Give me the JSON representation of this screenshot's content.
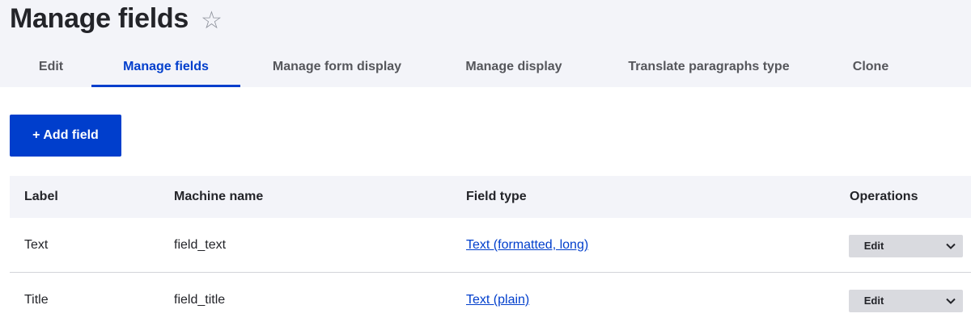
{
  "page": {
    "title": "Manage fields"
  },
  "tabs": [
    {
      "label": "Edit"
    },
    {
      "label": "Manage fields",
      "active": true
    },
    {
      "label": "Manage form display"
    },
    {
      "label": "Manage display"
    },
    {
      "label": "Translate paragraphs type"
    },
    {
      "label": "Clone"
    }
  ],
  "toolbar": {
    "add_field_label": "+ Add field"
  },
  "table": {
    "headers": [
      "Label",
      "Machine name",
      "Field type",
      "Operations"
    ],
    "rows": [
      {
        "label": "Text",
        "machine_name": "field_text",
        "field_type": "Text (formatted, long)",
        "operation": "Edit"
      },
      {
        "label": "Title",
        "machine_name": "field_title",
        "field_type": "Text (plain)",
        "operation": "Edit"
      }
    ]
  },
  "icons": {
    "favorite": "star-outline-icon",
    "dropdown": "chevron-down-icon"
  },
  "colors": {
    "accent": "#003ecc",
    "header_bg": "#f3f4f9",
    "text": "#232429",
    "muted": "#55565b",
    "button_secondary": "#d9dadf"
  }
}
